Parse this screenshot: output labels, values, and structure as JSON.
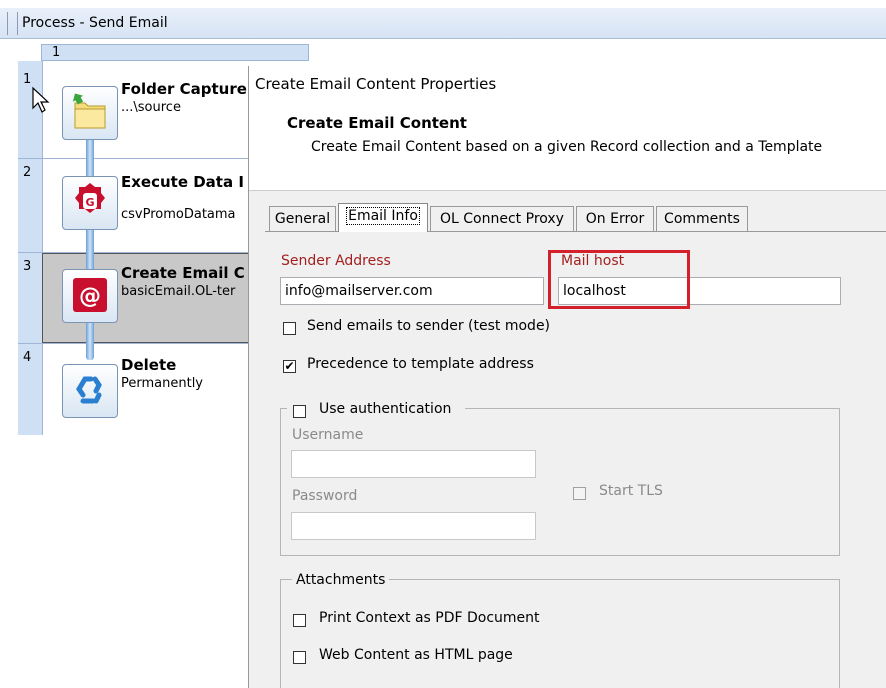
{
  "process": {
    "title": "Process - Send Email",
    "column_header": "1",
    "rows": [
      {
        "num": "1",
        "title": "Folder Capture",
        "sub": "...\\source"
      },
      {
        "num": "2",
        "title": "Execute Data I",
        "sub": "csvPromoDatama"
      },
      {
        "num": "3",
        "title": "Create Email C",
        "sub": "basicEmail.OL-ter"
      },
      {
        "num": "4",
        "title": "Delete",
        "sub": "Permanently"
      }
    ],
    "icons": [
      "folder-capture-icon",
      "execute-data-mapping-icon",
      "create-email-icon",
      "recycle-icon"
    ]
  },
  "dialog": {
    "window_title": "Create Email Content Properties",
    "heading": "Create Email Content",
    "description": "Create Email Content based on a given Record collection and a Template",
    "tabs": [
      "General",
      "Email Info",
      "OL Connect Proxy",
      "On Error",
      "Comments"
    ],
    "active_tab": "Email Info",
    "sender_label": "Sender Address",
    "sender_value": "info@mailserver.com",
    "mailhost_label": "Mail host",
    "mailhost_value": "localhost",
    "send_to_sender_label": "Send emails to sender (test mode)",
    "send_to_sender_checked": false,
    "precedence_label": "Precedence to template address",
    "precedence_checked": true,
    "auth_label": "Use authentication",
    "auth_checked": false,
    "username_label": "Username",
    "username_value": "",
    "password_label": "Password",
    "password_value": "",
    "start_tls_label": "Start TLS",
    "attachments_label": "Attachments",
    "print_pdf_label": "Print Context as PDF Document",
    "web_html_label": "Web Content as HTML page",
    "check_mark": "✔"
  },
  "colors": {
    "highlight": "#d4202a",
    "label_red": "#a32020",
    "grid_blue": "#cfe0f5"
  }
}
